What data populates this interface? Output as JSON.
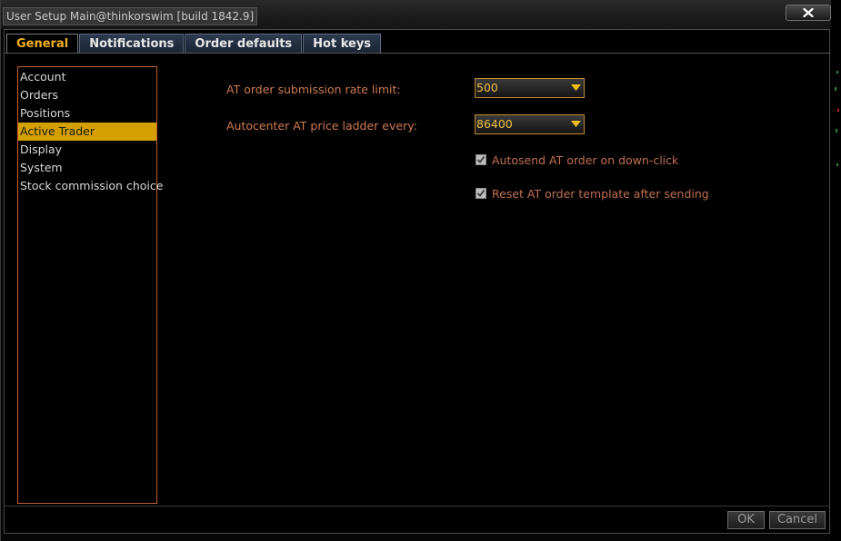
{
  "window": {
    "title": "User Setup Main@thinkorswim [build 1842.9]"
  },
  "tabs": [
    {
      "label": "General",
      "active": true
    },
    {
      "label": "Notifications",
      "active": false
    },
    {
      "label": "Order defaults",
      "active": false
    },
    {
      "label": "Hot keys",
      "active": false
    }
  ],
  "categories": [
    {
      "label": "Account",
      "selected": false
    },
    {
      "label": "Orders",
      "selected": false
    },
    {
      "label": "Positions",
      "selected": false
    },
    {
      "label": "Active Trader",
      "selected": true
    },
    {
      "label": "Display",
      "selected": false
    },
    {
      "label": "System",
      "selected": false
    },
    {
      "label": "Stock commission choice",
      "selected": false
    }
  ],
  "settings": {
    "rate_limit": {
      "label": "AT order submission rate limit:",
      "value": "500"
    },
    "autocenter": {
      "label": "Autocenter AT price ladder every:",
      "value": "86400"
    },
    "autosend": {
      "label": "Autosend AT order on down-click",
      "checked": true
    },
    "reset_template": {
      "label": "Reset AT order template after sending",
      "checked": true
    }
  },
  "buttons": {
    "ok": "OK",
    "cancel": "Cancel"
  },
  "colors": {
    "accent": "#f0b020",
    "selection": "#d4a000",
    "label_text": "#d07a50",
    "list_border": "#c06030"
  }
}
